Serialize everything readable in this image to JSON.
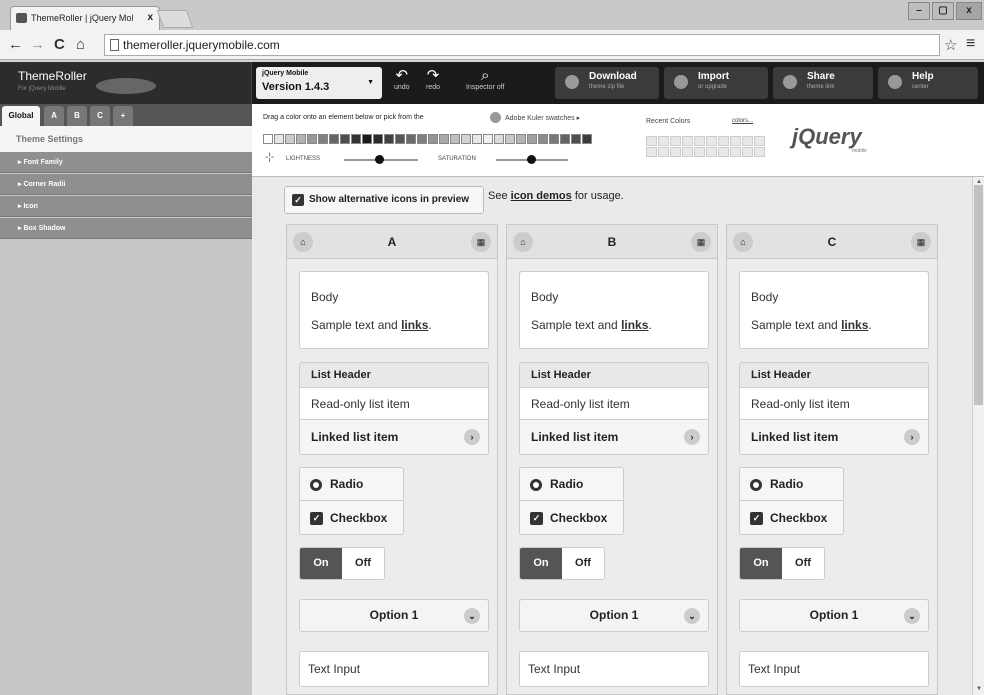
{
  "browser": {
    "tab_title": "ThemeRoller | jQuery Mol",
    "tab_close": "x",
    "url": "themeroller.jquerymobile.com",
    "nav": {
      "back": "←",
      "forward": "→",
      "reload": "C",
      "home": "⌂"
    }
  },
  "toolbar": {
    "app_title": "ThemeRoller",
    "app_sub": "For jQuery Mobile",
    "version_brand": "jQuery Mobile",
    "version_label": "Version 1.4.3",
    "undo": "undo",
    "redo": "redo",
    "inspector": "Inspector off",
    "download": {
      "label": "Download",
      "sub": "theme zip file"
    },
    "import": {
      "label": "Import",
      "sub": "or upgrade"
    },
    "share": {
      "label": "Share",
      "sub": "theme link"
    },
    "help": {
      "label": "Help",
      "sub": "center"
    }
  },
  "sidebar": {
    "tabs": [
      "Global",
      "A",
      "B",
      "C",
      "+"
    ],
    "header": "Theme Settings",
    "items": [
      "Font Family",
      "Corner Radii",
      "Icon",
      "Box Shadow"
    ]
  },
  "palette": {
    "instruction": "Drag a color onto an element below or pick from the",
    "kuler": "Adobe Kuler swatches ▸",
    "swatch_colors": [
      "#ffffff",
      "#e6e6e6",
      "#cccccc",
      "#b3b3b3",
      "#999999",
      "#808080",
      "#666666",
      "#4d4d4d",
      "#333333",
      "#1a1a1a",
      "#2b2b2b",
      "#404040",
      "#555555",
      "#6a6a6a",
      "#7f7f7f",
      "#949494",
      "#a9a9a9",
      "#bebebe",
      "#d3d3d3",
      "#e8e8e8",
      "#f0f0f0",
      "#dcdcdc",
      "#c8c8c8",
      "#b4b4b4",
      "#a0a0a0",
      "#8c8c8c",
      "#787878",
      "#646464",
      "#505050",
      "#3c3c3c"
    ],
    "lightness": "LIGHTNESS",
    "saturation": "SATURATION",
    "recent_colors": "Recent Colors",
    "colors_link": "colors...",
    "brand": "jQuery",
    "brand_sub": "mobile"
  },
  "content": {
    "alt_icons_label": "Show alternative icons in preview",
    "see_text_pre": "See ",
    "see_link": "icon demos",
    "see_text_post": " for usage.",
    "columns": [
      {
        "swatch": "A"
      },
      {
        "swatch": "B"
      },
      {
        "swatch": "C"
      }
    ],
    "body_title": "Body",
    "body_text_pre": "Sample text and ",
    "body_link": "links",
    "body_text_post": ".",
    "list_header": "List Header",
    "list_readonly": "Read-only list item",
    "list_linked": "Linked list item",
    "radio": "Radio",
    "checkbox": "Checkbox",
    "flip_on": "On",
    "flip_off": "Off",
    "select_value": "Option 1",
    "text_input": "Text Input"
  }
}
